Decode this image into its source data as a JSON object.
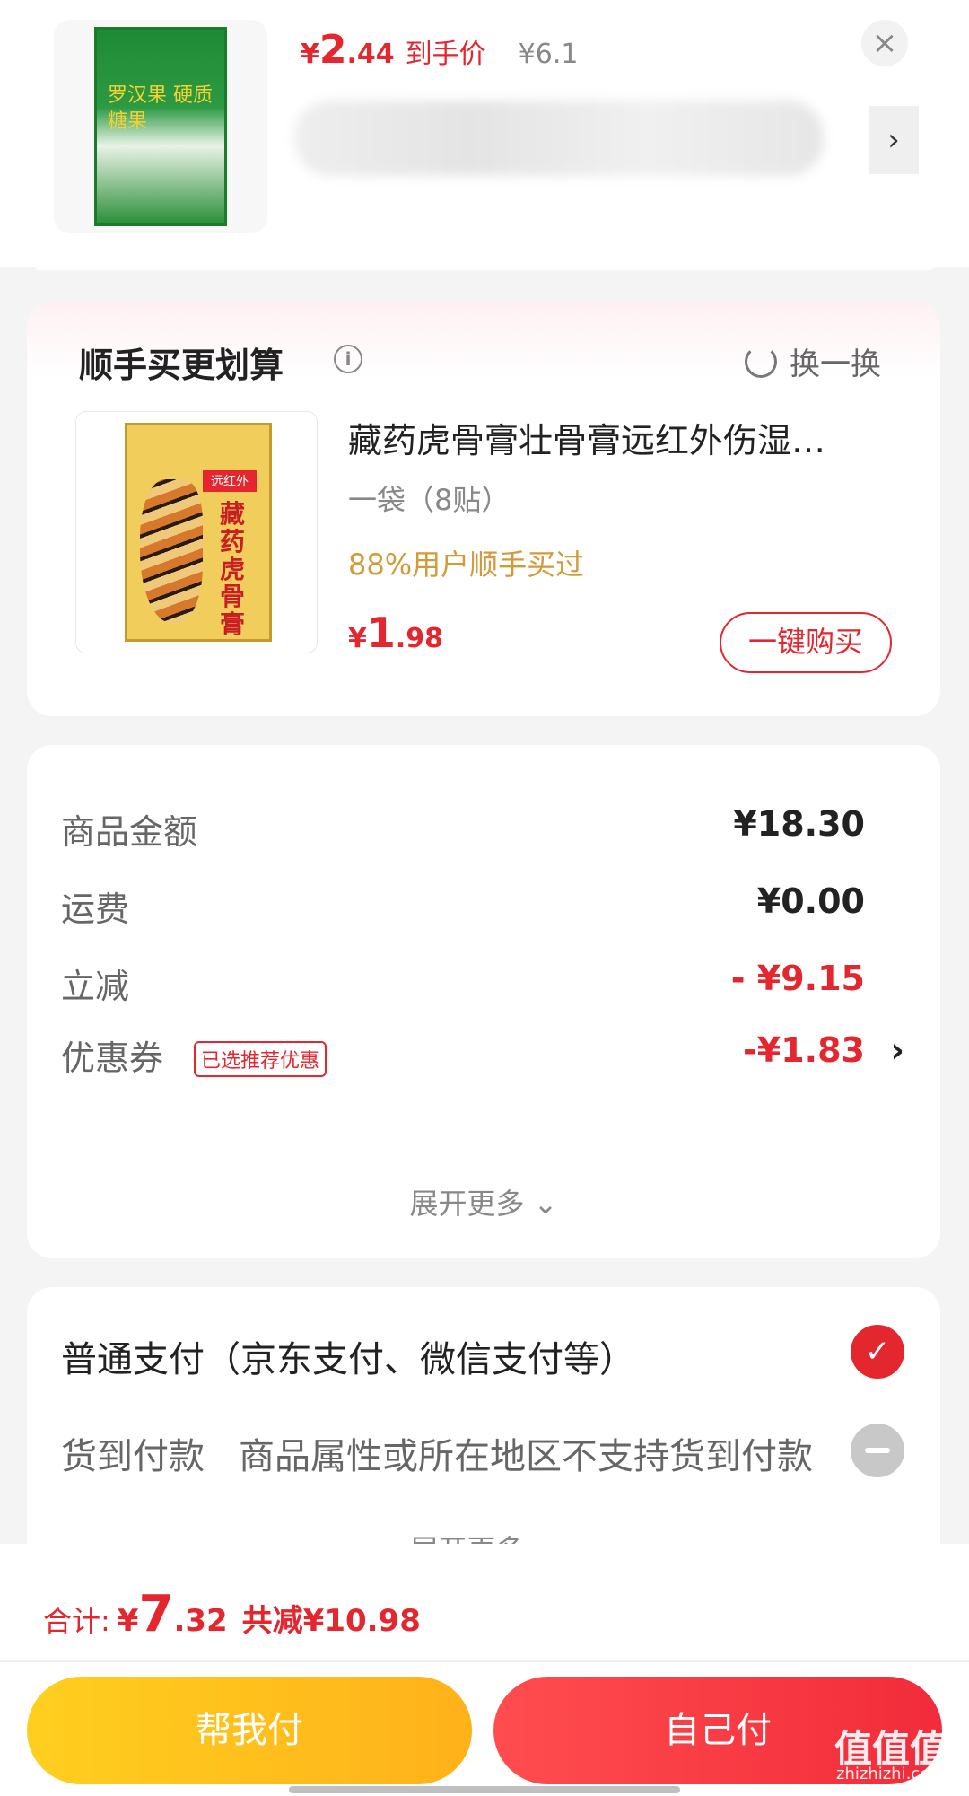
{
  "top_product": {
    "box_text": "罗汉果 硬质糖果",
    "price_yen": "¥",
    "price_int": "2",
    "price_dec": ".44",
    "price_tag": "到手价",
    "orig_price": "¥6.1"
  },
  "addon": {
    "title": "顺手买更划算",
    "swap_label": "换一换",
    "box_label": "远红外",
    "box_name": "藏药虎骨膏",
    "name": "藏药虎骨膏壮骨膏远红外伤湿…",
    "spec": "一袋（8贴）",
    "pct": "88%用户顺手买过",
    "price_yen": "¥",
    "price_int": "1",
    "price_dec": ".98",
    "buy_label": "一键购买"
  },
  "summary": {
    "rows": [
      {
        "label": "商品金额",
        "value": "¥18.30"
      },
      {
        "label": "运费",
        "value": "¥0.00"
      },
      {
        "label": "立减",
        "value": "- ¥9.15"
      },
      {
        "label": "优惠券",
        "badge": "已选推荐优惠",
        "value": "-¥1.83"
      }
    ],
    "expand": "展开更多 ⌄"
  },
  "payment": {
    "normal_label": "普通支付（京东支付、微信支付等）",
    "cod_label": "货到付款",
    "cod_desc": "商品属性或所在地区不支持货到付款",
    "expand": "展开更多 ⌄"
  },
  "bottom": {
    "total_label": "合计:",
    "total_yen": "¥",
    "total_int": "7",
    "total_dec": ".32",
    "save_label": "共减¥10.98",
    "help_btn": "帮我付",
    "self_btn": "自己付"
  },
  "watermark": {
    "main": "值值值",
    "sub": "zhizhizhi.com"
  },
  "colors": {
    "accent": "#e4262f",
    "gold": "#d39a3a",
    "help": "#ffc21d"
  }
}
